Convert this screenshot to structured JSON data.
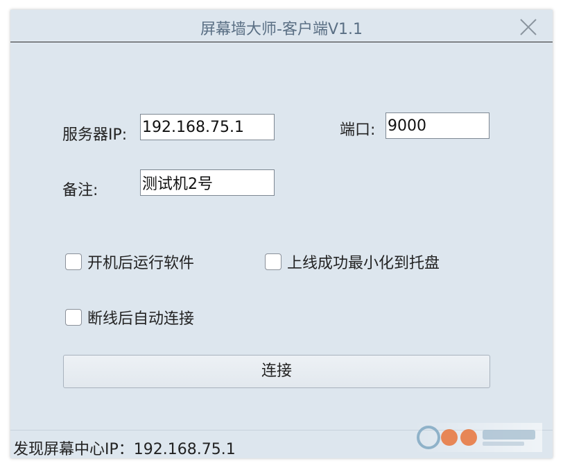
{
  "window": {
    "title": "屏幕墙大师-客户端V1.1"
  },
  "form": {
    "server_ip_label": "服务器IP:",
    "server_ip_value": "192.168.75.1",
    "port_label": "端口:",
    "port_value": "9000",
    "note_label": "备注:",
    "note_value": "测试机2号"
  },
  "options": {
    "autostart_label": "开机后运行软件",
    "autostart_checked": false,
    "minimize_label": "上线成功最小化到托盘",
    "minimize_checked": false,
    "reconnect_label": "断线后自动连接",
    "reconnect_checked": false
  },
  "actions": {
    "connect_label": "连接"
  },
  "status": {
    "text": "发现屏幕中心IP：192.168.75.1"
  },
  "watermark": {
    "icon": "site-logo-icon"
  },
  "colors": {
    "window_bg": "#dde6ee",
    "title_text": "#5a6f84"
  }
}
